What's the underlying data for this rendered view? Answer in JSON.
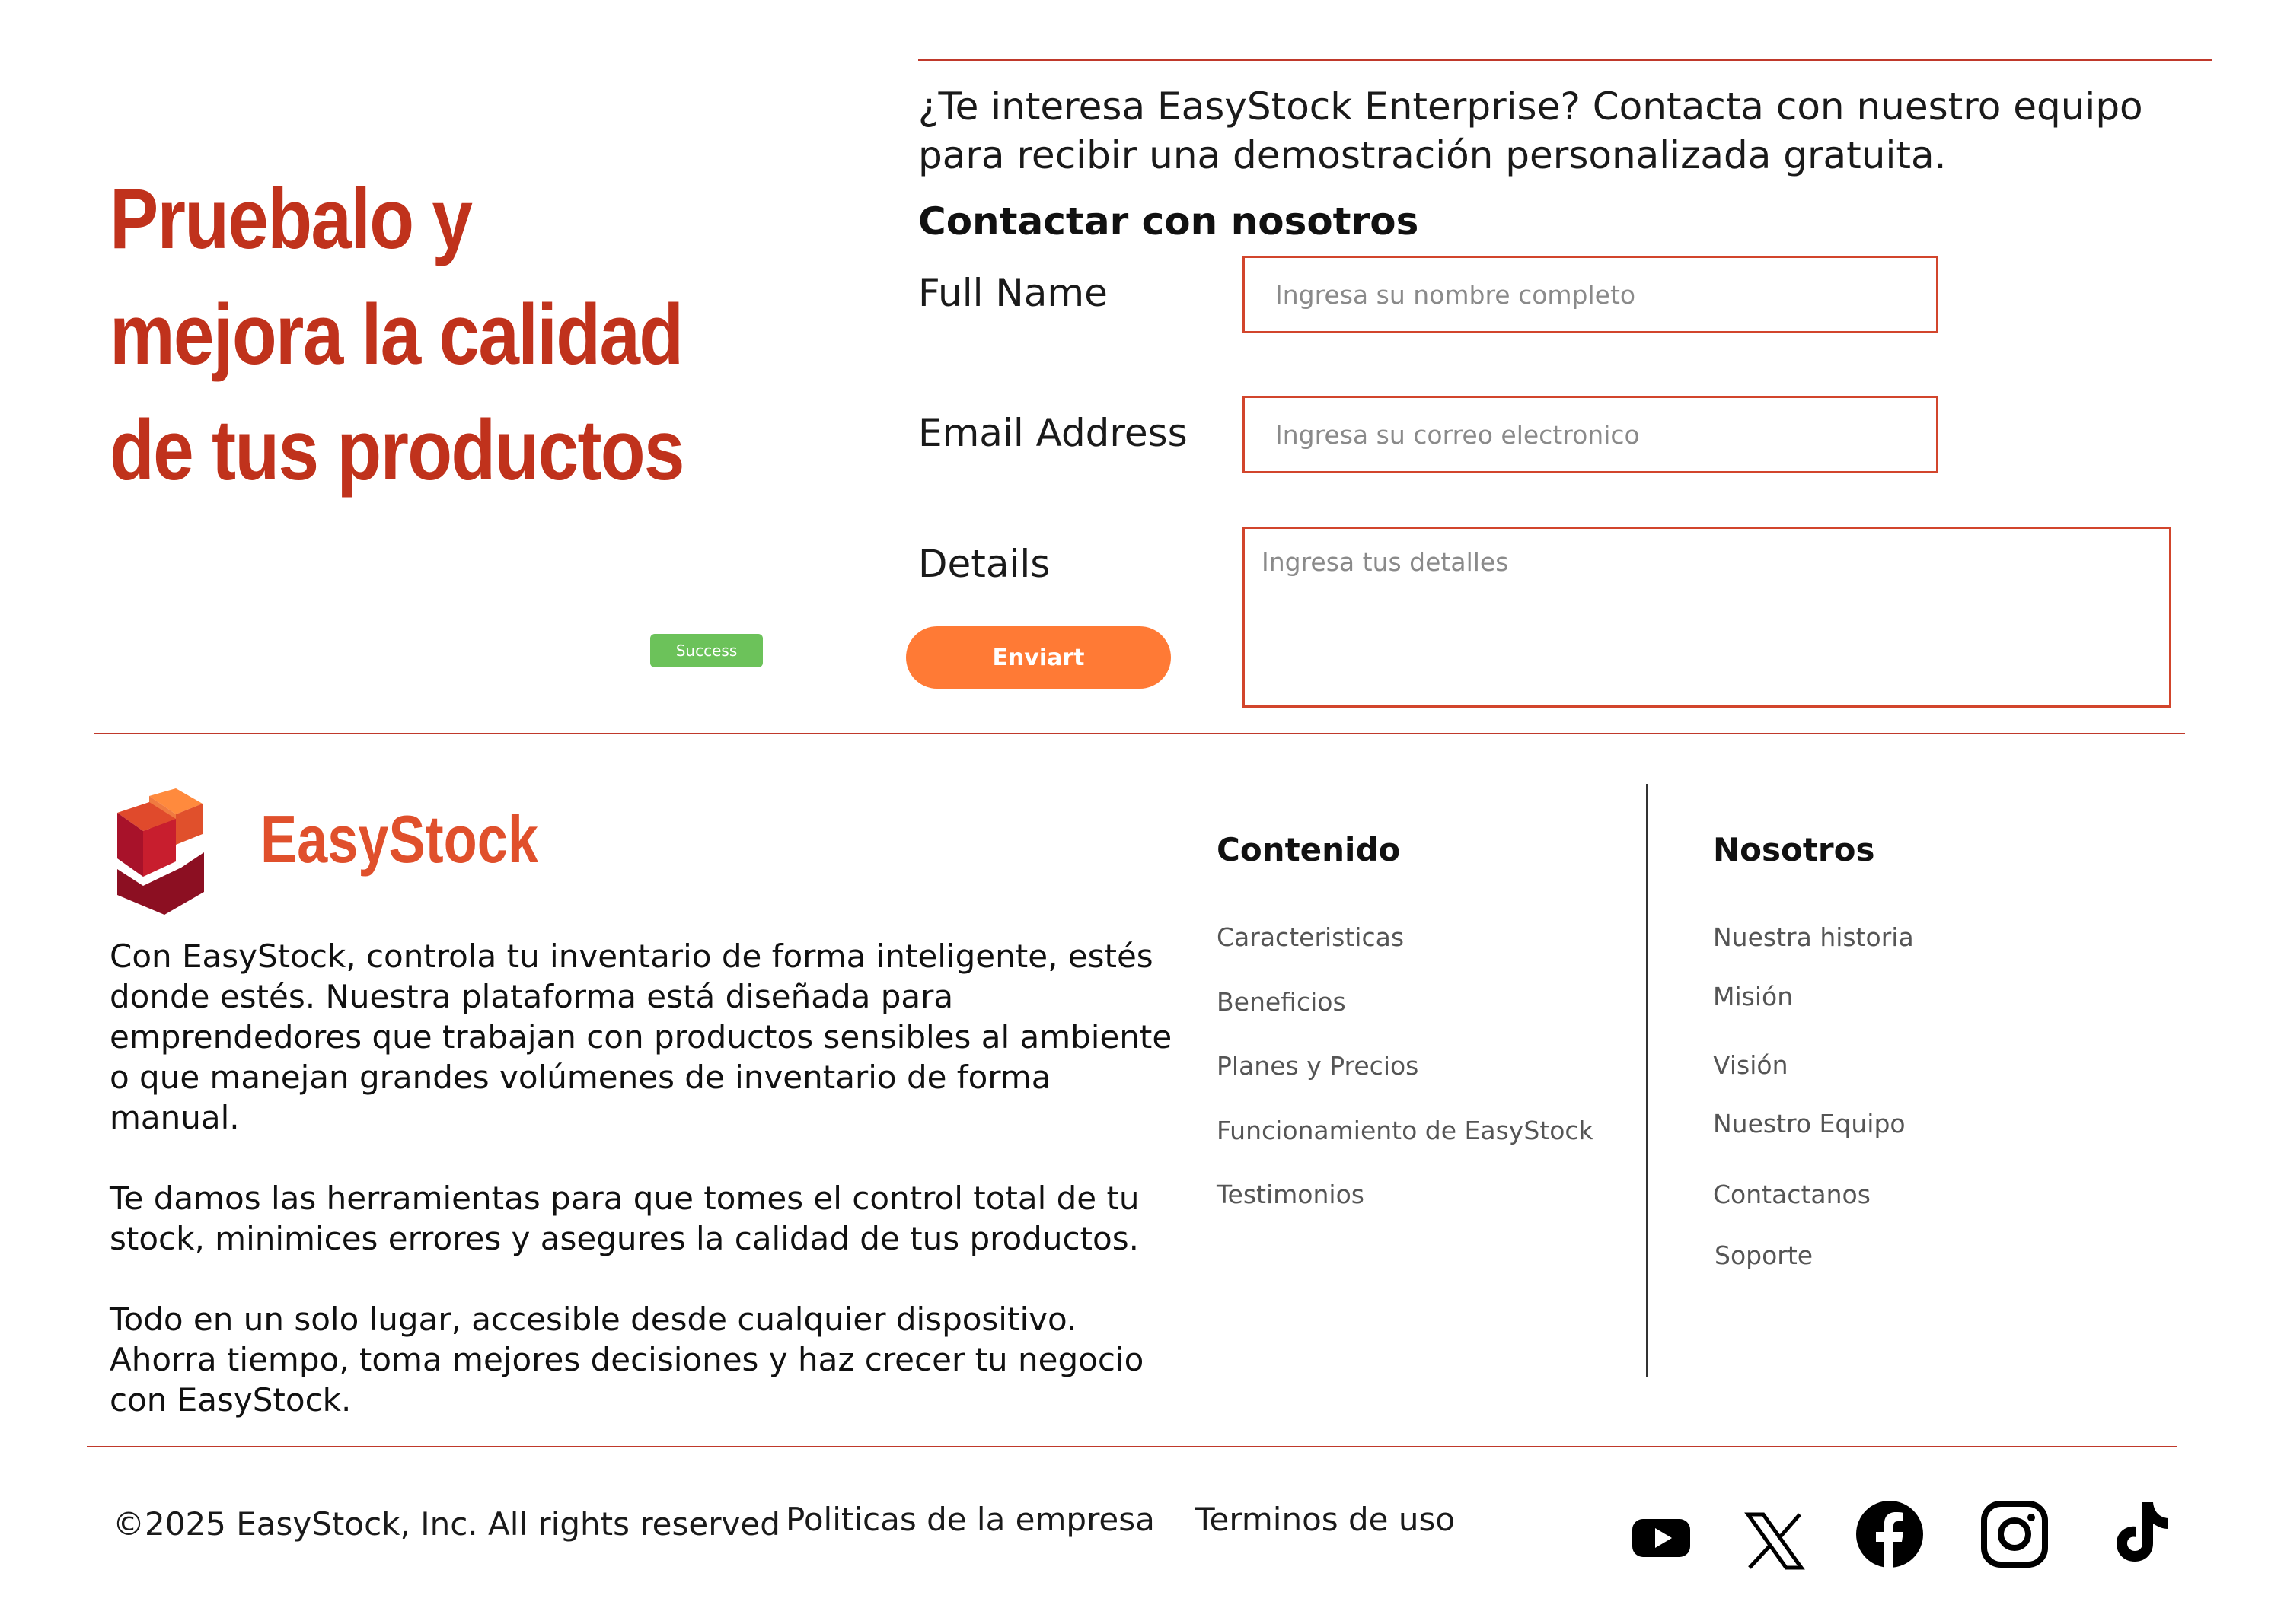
{
  "hero": {
    "line1": "Pruebalo y",
    "line2": "mejora la calidad",
    "line3": "de tus productos"
  },
  "contact": {
    "intro": "¿Te interesa EasyStock Enterprise? Contacta con nuestro equipo para recibir una demostración personalizada gratuita.",
    "heading": "Contactar con nosotros",
    "full_name_label": "Full Name",
    "full_name_placeholder": "Ingresa su nombre completo",
    "email_label": "Email Address",
    "email_placeholder": "Ingresa su correo electronico",
    "details_label": "Details",
    "details_placeholder": "Ingresa tus detalles",
    "submit_label": "Enviart",
    "success_label": "Success"
  },
  "brand": {
    "name": "EasyStock",
    "accent_color": "#c0321c",
    "button_color": "#ff7a35",
    "logo_icon": "stacked-cubes-icon"
  },
  "about": {
    "p1": "Con EasyStock, controla tu inventario de forma inteligente, estés donde estés. Nuestra plataforma está diseñada para emprendedores que trabajan con productos sensibles al ambiente o que manejan grandes volúmenes de inventario de forma manual.",
    "p2": "Te damos las herramientas para que tomes el control total de tu stock, minimices errores y asegures la calidad de tus productos.",
    "p3": "Todo en un solo lugar, accesible desde cualquier dispositivo. Ahorra tiempo, toma mejores decisiones y haz crecer tu negocio con EasyStock."
  },
  "contenido": {
    "heading": "Contenido",
    "links": [
      "Caracteristicas",
      "Beneficios",
      "Planes y Precios",
      "Funcionamiento de EasyStock",
      "Testimonios"
    ]
  },
  "nosotros": {
    "heading": "Nosotros",
    "links": [
      "Nuestra historia",
      "Misión",
      "Visión",
      "Nuestro Equipo",
      "Contactanos",
      "Soporte"
    ]
  },
  "footer": {
    "copyright": "©2025 EasyStock, Inc. All rights reserved",
    "policies": "Politicas de la empresa",
    "terms": "Terminos de uso",
    "social_icons": [
      "youtube-icon",
      "x-icon",
      "facebook-icon",
      "instagram-icon",
      "tiktok-icon"
    ]
  }
}
